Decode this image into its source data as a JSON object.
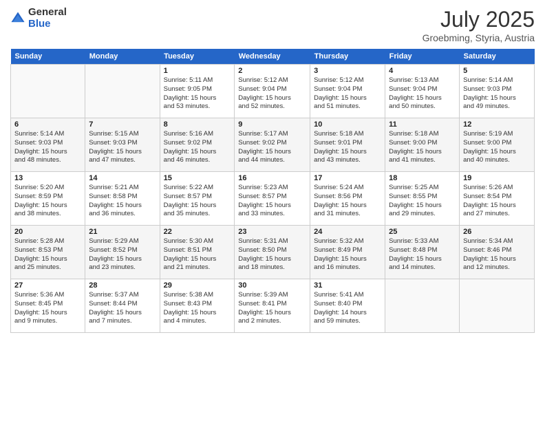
{
  "logo": {
    "general": "General",
    "blue": "Blue"
  },
  "title": "July 2025",
  "location": "Groebming, Styria, Austria",
  "days_of_week": [
    "Sunday",
    "Monday",
    "Tuesday",
    "Wednesday",
    "Thursday",
    "Friday",
    "Saturday"
  ],
  "weeks": [
    [
      {
        "num": "",
        "info": ""
      },
      {
        "num": "",
        "info": ""
      },
      {
        "num": "1",
        "info": "Sunrise: 5:11 AM\nSunset: 9:05 PM\nDaylight: 15 hours\nand 53 minutes."
      },
      {
        "num": "2",
        "info": "Sunrise: 5:12 AM\nSunset: 9:04 PM\nDaylight: 15 hours\nand 52 minutes."
      },
      {
        "num": "3",
        "info": "Sunrise: 5:12 AM\nSunset: 9:04 PM\nDaylight: 15 hours\nand 51 minutes."
      },
      {
        "num": "4",
        "info": "Sunrise: 5:13 AM\nSunset: 9:04 PM\nDaylight: 15 hours\nand 50 minutes."
      },
      {
        "num": "5",
        "info": "Sunrise: 5:14 AM\nSunset: 9:03 PM\nDaylight: 15 hours\nand 49 minutes."
      }
    ],
    [
      {
        "num": "6",
        "info": "Sunrise: 5:14 AM\nSunset: 9:03 PM\nDaylight: 15 hours\nand 48 minutes."
      },
      {
        "num": "7",
        "info": "Sunrise: 5:15 AM\nSunset: 9:03 PM\nDaylight: 15 hours\nand 47 minutes."
      },
      {
        "num": "8",
        "info": "Sunrise: 5:16 AM\nSunset: 9:02 PM\nDaylight: 15 hours\nand 46 minutes."
      },
      {
        "num": "9",
        "info": "Sunrise: 5:17 AM\nSunset: 9:02 PM\nDaylight: 15 hours\nand 44 minutes."
      },
      {
        "num": "10",
        "info": "Sunrise: 5:18 AM\nSunset: 9:01 PM\nDaylight: 15 hours\nand 43 minutes."
      },
      {
        "num": "11",
        "info": "Sunrise: 5:18 AM\nSunset: 9:00 PM\nDaylight: 15 hours\nand 41 minutes."
      },
      {
        "num": "12",
        "info": "Sunrise: 5:19 AM\nSunset: 9:00 PM\nDaylight: 15 hours\nand 40 minutes."
      }
    ],
    [
      {
        "num": "13",
        "info": "Sunrise: 5:20 AM\nSunset: 8:59 PM\nDaylight: 15 hours\nand 38 minutes."
      },
      {
        "num": "14",
        "info": "Sunrise: 5:21 AM\nSunset: 8:58 PM\nDaylight: 15 hours\nand 36 minutes."
      },
      {
        "num": "15",
        "info": "Sunrise: 5:22 AM\nSunset: 8:57 PM\nDaylight: 15 hours\nand 35 minutes."
      },
      {
        "num": "16",
        "info": "Sunrise: 5:23 AM\nSunset: 8:57 PM\nDaylight: 15 hours\nand 33 minutes."
      },
      {
        "num": "17",
        "info": "Sunrise: 5:24 AM\nSunset: 8:56 PM\nDaylight: 15 hours\nand 31 minutes."
      },
      {
        "num": "18",
        "info": "Sunrise: 5:25 AM\nSunset: 8:55 PM\nDaylight: 15 hours\nand 29 minutes."
      },
      {
        "num": "19",
        "info": "Sunrise: 5:26 AM\nSunset: 8:54 PM\nDaylight: 15 hours\nand 27 minutes."
      }
    ],
    [
      {
        "num": "20",
        "info": "Sunrise: 5:28 AM\nSunset: 8:53 PM\nDaylight: 15 hours\nand 25 minutes."
      },
      {
        "num": "21",
        "info": "Sunrise: 5:29 AM\nSunset: 8:52 PM\nDaylight: 15 hours\nand 23 minutes."
      },
      {
        "num": "22",
        "info": "Sunrise: 5:30 AM\nSunset: 8:51 PM\nDaylight: 15 hours\nand 21 minutes."
      },
      {
        "num": "23",
        "info": "Sunrise: 5:31 AM\nSunset: 8:50 PM\nDaylight: 15 hours\nand 18 minutes."
      },
      {
        "num": "24",
        "info": "Sunrise: 5:32 AM\nSunset: 8:49 PM\nDaylight: 15 hours\nand 16 minutes."
      },
      {
        "num": "25",
        "info": "Sunrise: 5:33 AM\nSunset: 8:48 PM\nDaylight: 15 hours\nand 14 minutes."
      },
      {
        "num": "26",
        "info": "Sunrise: 5:34 AM\nSunset: 8:46 PM\nDaylight: 15 hours\nand 12 minutes."
      }
    ],
    [
      {
        "num": "27",
        "info": "Sunrise: 5:36 AM\nSunset: 8:45 PM\nDaylight: 15 hours\nand 9 minutes."
      },
      {
        "num": "28",
        "info": "Sunrise: 5:37 AM\nSunset: 8:44 PM\nDaylight: 15 hours\nand 7 minutes."
      },
      {
        "num": "29",
        "info": "Sunrise: 5:38 AM\nSunset: 8:43 PM\nDaylight: 15 hours\nand 4 minutes."
      },
      {
        "num": "30",
        "info": "Sunrise: 5:39 AM\nSunset: 8:41 PM\nDaylight: 15 hours\nand 2 minutes."
      },
      {
        "num": "31",
        "info": "Sunrise: 5:41 AM\nSunset: 8:40 PM\nDaylight: 14 hours\nand 59 minutes."
      },
      {
        "num": "",
        "info": ""
      },
      {
        "num": "",
        "info": ""
      }
    ]
  ]
}
